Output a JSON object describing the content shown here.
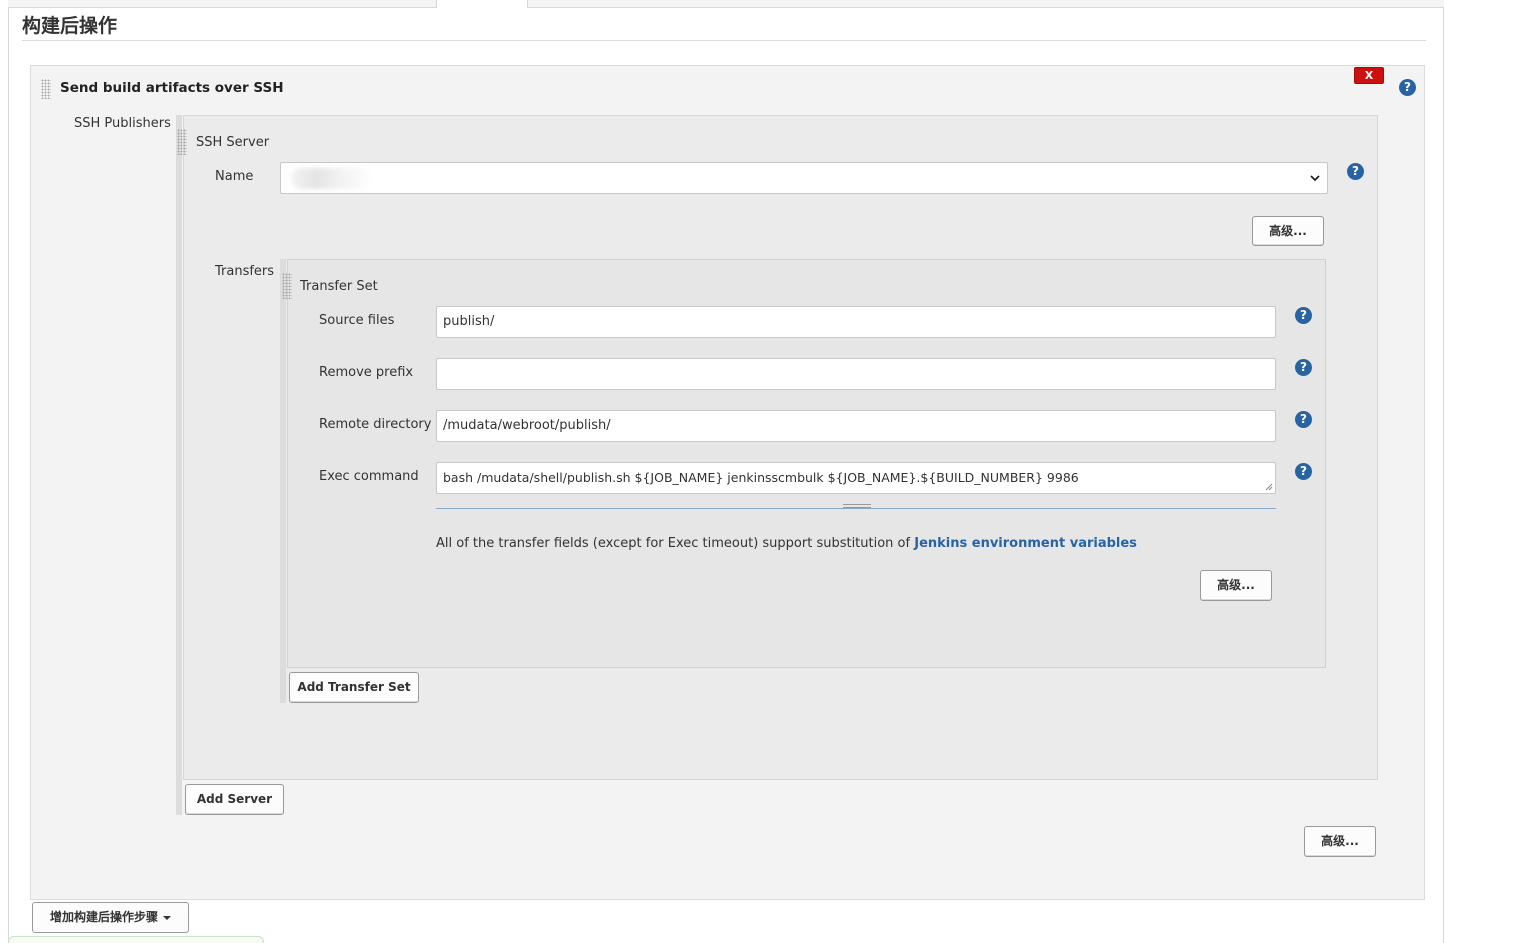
{
  "section": {
    "title": "构建后操作"
  },
  "publisher": {
    "title": "Send build artifacts over SSH",
    "delete_label": "X",
    "help_symbol": "?",
    "ssh_publishers_label": "SSH Publishers"
  },
  "server": {
    "title": "SSH Server",
    "name_label": "Name",
    "name_value": "",
    "advanced_label": "高级...",
    "transfers_label": "Transfers",
    "add_server_label": "Add Server"
  },
  "transfer_set": {
    "title": "Transfer Set",
    "fields": [
      {
        "label": "Source files",
        "value": "publish/"
      },
      {
        "label": "Remove prefix",
        "value": ""
      },
      {
        "label": "Remote directory",
        "value": "/mudata/webroot/publish/"
      },
      {
        "label": "Exec command",
        "value": "bash /mudata/shell/publish.sh  ${JOB_NAME} jenkinsscmbulk ${JOB_NAME}.${BUILD_NUMBER}  9986"
      }
    ],
    "info_text": "All of the transfer fields (except for Exec timeout) support substitution of ",
    "info_link": "Jenkins environment variables",
    "advanced_label": "高级...",
    "add_transfer_set_label": "Add Transfer Set"
  },
  "publisher_advanced_label": "高级...",
  "add_step_label": "增加构建后操作步骤",
  "colors": {
    "help_blue": "#2864a4",
    "delete_red": "#cc1010",
    "link_blue": "#2864a4"
  },
  "icons": {
    "help": "help-icon",
    "delete": "delete-icon",
    "dropdown": "chevron-down-icon",
    "drag": "drag-handle-icon"
  }
}
